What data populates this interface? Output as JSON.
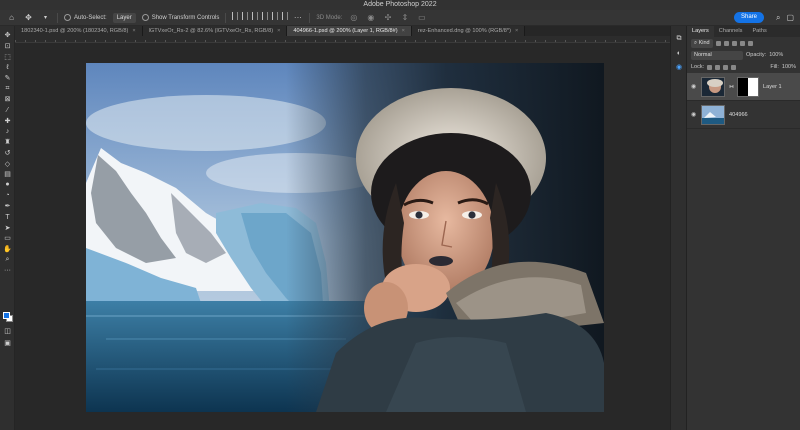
{
  "app": {
    "title": "Adobe Photoshop 2022"
  },
  "options": {
    "auto_select_label": "Auto-Select:",
    "auto_select_value": "Layer",
    "transform_label": "Show Transform Controls",
    "mode_3d": "3D Mode:",
    "share_label": "Share"
  },
  "tabs": [
    {
      "label": "1802340-1.psd @ 200% (1802340, RGB/8)",
      "active": false
    },
    {
      "label": "lGTVxeOr_Rs-2 @ 82.6% (lGTVxeOr_Rs, RGB/8)",
      "active": false
    },
    {
      "label": "404966-1.psd @ 200% (Layer 1, RGB/8#)",
      "active": true
    },
    {
      "label": "rez-Enhanced.dng @ 100% (RGB/8*)",
      "active": false
    }
  ],
  "layers_panel": {
    "tabs": [
      "Layers",
      "Channels",
      "Paths"
    ],
    "filter_label": "Kind",
    "blend_mode": "Normal",
    "opacity_label": "Opacity:",
    "opacity_value": "100%",
    "lock_label": "Lock:",
    "fill_label": "Fill:",
    "fill_value": "100%",
    "layers": [
      {
        "name": "Layer 1",
        "selected": true,
        "has_mask": true
      },
      {
        "name": "404966",
        "selected": false,
        "has_mask": false
      }
    ]
  },
  "colors": {
    "accent": "#1473e6",
    "foreground_swatch": "#1473e6",
    "background_swatch": "#ffffff"
  },
  "icons": {
    "toolbar": [
      "move-icon",
      "artboard-icon",
      "marquee-icon",
      "lasso-icon",
      "quick-select-icon",
      "crop-icon",
      "frame-icon",
      "eyedropper-icon",
      "healing-icon",
      "brush-icon",
      "stamp-icon",
      "history-brush-icon",
      "eraser-icon",
      "gradient-icon",
      "blur-icon",
      "dodge-icon",
      "pen-icon",
      "type-icon",
      "path-select-icon",
      "rectangle-icon",
      "hand-icon",
      "zoom-icon",
      "more-icon"
    ]
  }
}
